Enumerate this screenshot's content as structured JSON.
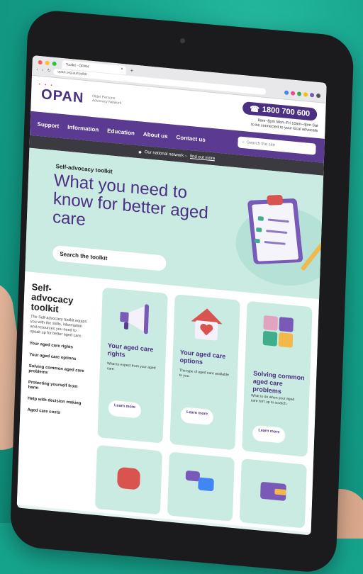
{
  "browser": {
    "tab_title": "Toolkit - OPAN",
    "url": "opan.org.au/toolkit",
    "nav_glyphs": "‹ › ↻",
    "new_tab_symbol": "+",
    "close_symbol": "×"
  },
  "header": {
    "logo": "OPAN",
    "logo_subtitle": "Older Persons Advocacy Network",
    "phone": "1800 700 600",
    "hours_line1": "8am–8pm Mon–Fri 10am–4pm Sat",
    "hours_line2": "to be connected to your local advocate"
  },
  "nav": {
    "items": [
      "Support",
      "Information",
      "Education",
      "About us",
      "Contact us"
    ],
    "search_placeholder": "Search the site"
  },
  "network_bar": {
    "text": "Our national network –",
    "link": "find out more"
  },
  "hero": {
    "kicker": "Self-advocacy toolkit",
    "title": "What you need to know for better aged care",
    "search_label": "Search the toolkit"
  },
  "sidebar": {
    "title": "Self-advocacy toolkit",
    "description": "The Self-advocacy toolkit equips you with the skills, information and resources you need to speak up for better aged care.",
    "links": [
      "Your aged care rights",
      "Your aged care options",
      "Solving common aged care problems",
      "Protecting yourself from harm",
      "Help with decision making",
      "Aged care costs"
    ]
  },
  "cards": [
    {
      "title": "Your aged care rights",
      "sub": "What to expect from your aged care.",
      "button": "Learn more",
      "icon": "megaphone-icon"
    },
    {
      "title": "Your aged care options",
      "sub": "The type of aged care available to you.",
      "button": "Learn more",
      "icon": "house-heart-icon"
    },
    {
      "title": "Solving common aged care problems",
      "sub": "What to do when your aged care isn't up to scratch.",
      "button": "Learn more",
      "icon": "puzzle-icon"
    }
  ],
  "colors": {
    "background": "#16a38c",
    "brand_purple": "#4b2f82",
    "nav_purple": "#5b3a91",
    "hero_mint": "#c9ebe2"
  }
}
